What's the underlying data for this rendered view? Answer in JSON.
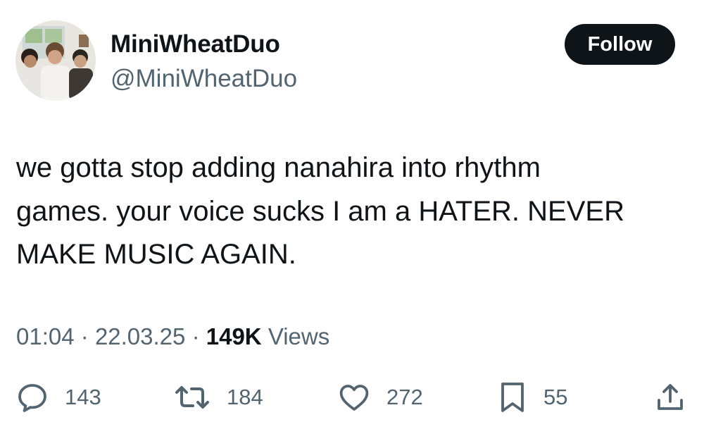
{
  "user": {
    "display_name": "MiniWheatDuo",
    "handle": "@MiniWheatDuo",
    "follow_label": "Follow"
  },
  "tweet": {
    "text_lines": [
      "we gotta stop adding nanahira into rhythm",
      "games.  your voice sucks I am a HATER.  NEVER",
      "MAKE MUSIC AGAIN."
    ],
    "time": "01:04",
    "separator": "·",
    "date": "22.03.25",
    "views_count": "149K",
    "views_label": "Views"
  },
  "actions": {
    "replies": "143",
    "reposts": "184",
    "likes": "272",
    "bookmarks": "55"
  },
  "icons": {
    "reply": "reply-icon",
    "repost": "repost-icon",
    "like": "heart-icon",
    "bookmark": "bookmark-icon",
    "share": "share-icon"
  },
  "colors": {
    "text_primary": "#0f1419",
    "text_secondary": "#536471",
    "button_bg": "#0f1419",
    "button_text": "#ffffff"
  }
}
